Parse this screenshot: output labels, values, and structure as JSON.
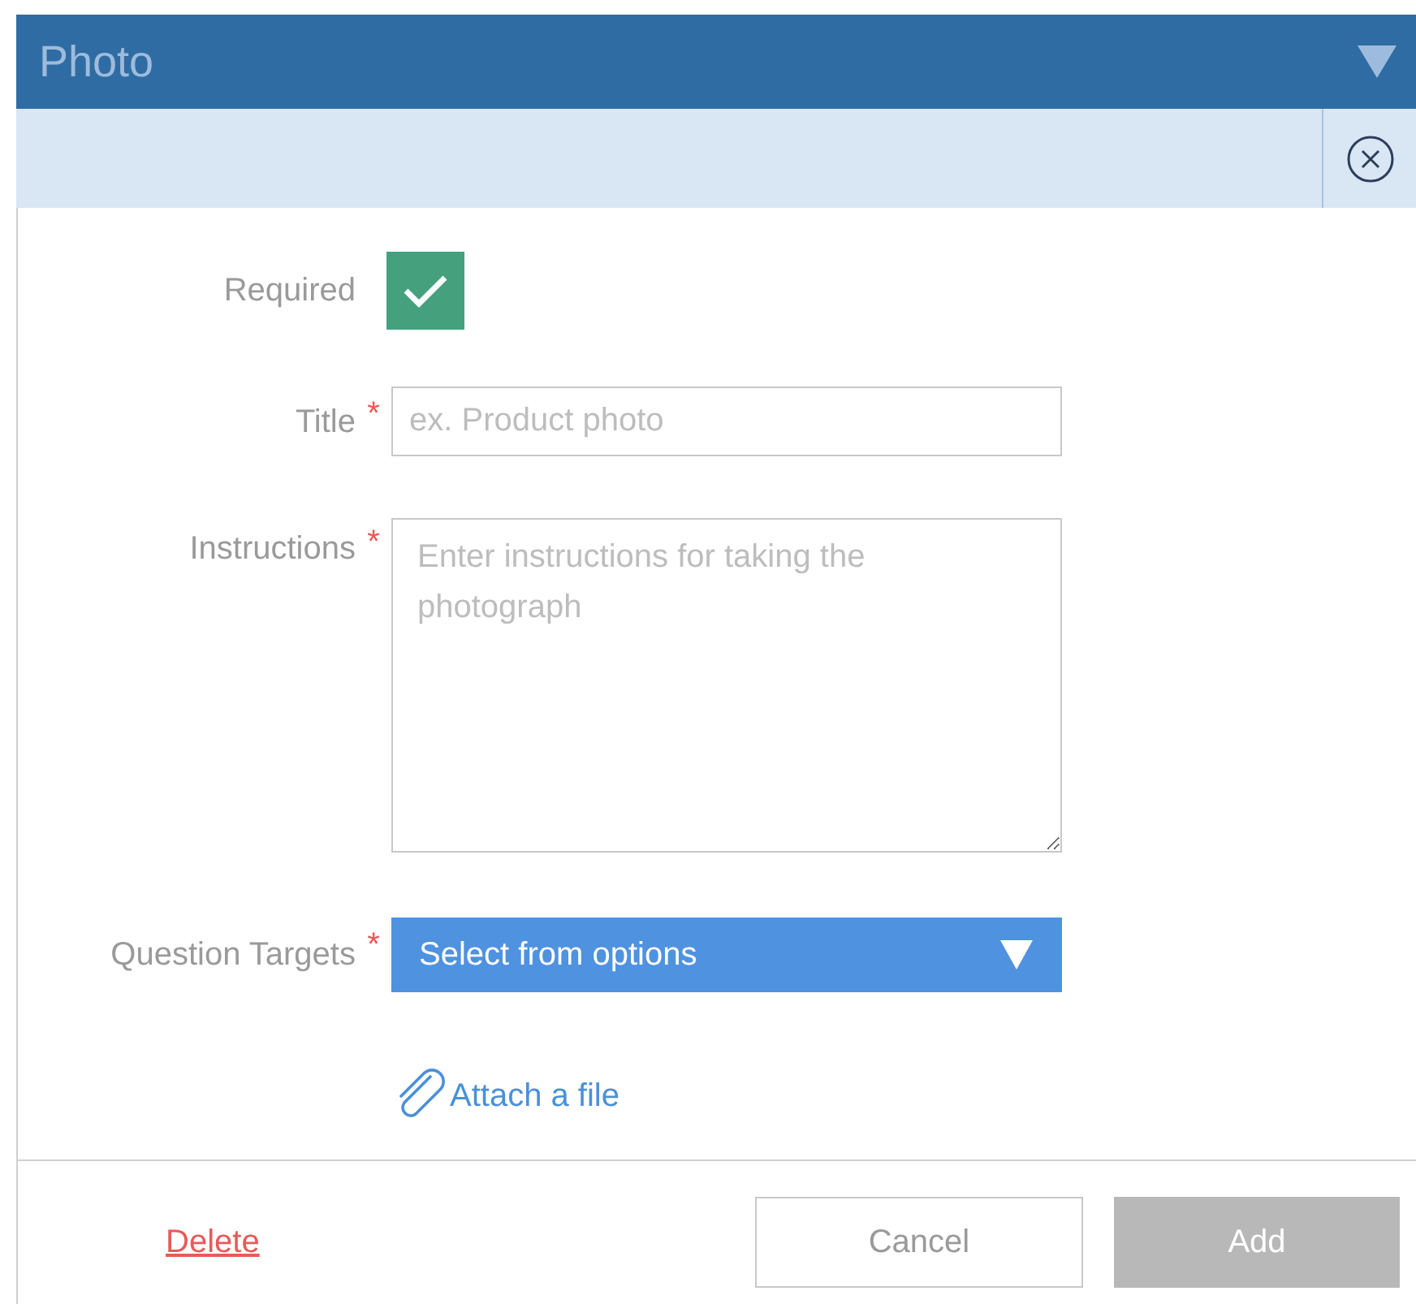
{
  "header": {
    "title": "Photo"
  },
  "required_toggle": {
    "label": "Required",
    "checked": true
  },
  "fields": [
    {
      "kind": "input",
      "label": "Title",
      "required_mark": "*",
      "placeholder": "ex. Product photo"
    },
    {
      "kind": "textarea",
      "label": "Instructions",
      "required_mark": "*",
      "placeholder": "Enter instructions for taking the photograph"
    },
    {
      "kind": "select",
      "label": "Question Targets",
      "required_mark": "*",
      "placeholder": "Select from options"
    }
  ],
  "attach_link": "Attach a file",
  "footer": {
    "delete": "Delete",
    "cancel": "Cancel",
    "add": {
      "label": "Add",
      "disabled": true
    }
  }
}
